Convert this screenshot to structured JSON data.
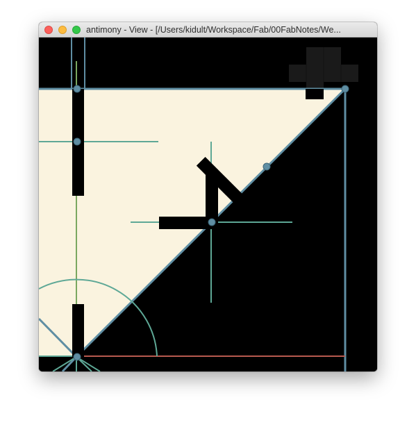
{
  "window": {
    "title": "antimony - View - [/Users/kidult/Workspace/Fab/00FabNotes/We..."
  },
  "colors": {
    "background": "#000000",
    "shape_fill": "#faf3df",
    "outline": "#5f8ea3",
    "guide": "#5ea896",
    "x_axis": "#b85a4f",
    "y_axis": "#7aa860",
    "handle": "#000000",
    "control_point": "#5f8ea3"
  },
  "icons": {
    "close": "close-button",
    "minimize": "minimize-button",
    "maximize": "zoom-button",
    "move_arrow": "diagonal-arrow-icon",
    "viewcube": "view-cube-icon"
  }
}
